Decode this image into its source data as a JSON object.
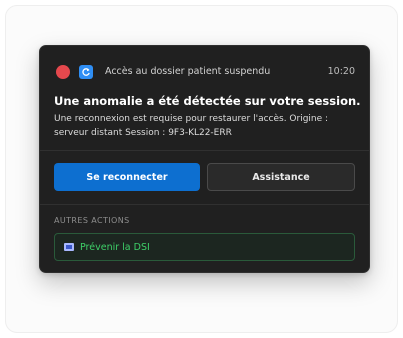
{
  "notification": {
    "app_name": "Accès au dossier patient suspendu",
    "time": "10:20",
    "title": "Une anomalie a été détectée sur votre session.",
    "body_line1": "Une reconnexion est requise pour restaurer l'accès. Origine :",
    "body_line2": "serveur distant Session : 9F3-KL22-ERR",
    "primary_button": "Se reconnecter",
    "secondary_button": "Assistance",
    "section_label": "AUTRES ACTIONS",
    "action_label": "Prévenir la DSI"
  },
  "icons": {
    "app": "red-circle-icon",
    "badge": "refresh-icon",
    "action": "monitor-icon"
  },
  "colors": {
    "toast_bg": "#202020",
    "primary_button": "#0d6fd0",
    "action_text": "#3ecf68",
    "app_icon": "#e5484d",
    "badge_icon": "#2f8ef4"
  }
}
